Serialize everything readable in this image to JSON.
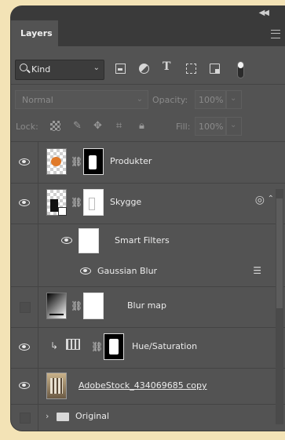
{
  "panel": {
    "tab_label": "Layers",
    "collapse_icon": "double-chevron-left-icon",
    "menu_icon": "hamburger-menu-icon"
  },
  "filter": {
    "kind_label": "Kind",
    "icons": [
      "pixel-filter-icon",
      "adjustment-filter-icon",
      "type-filter-icon",
      "shape-filter-icon",
      "smart-object-filter-icon",
      "filter-toggle-icon"
    ]
  },
  "blend": {
    "mode": "Normal",
    "opacity_label": "Opacity:",
    "opacity_value": "100%"
  },
  "lock": {
    "label": "Lock:",
    "fill_label": "Fill:",
    "fill_value": "100%"
  },
  "layers": [
    {
      "name": "Produkter",
      "visible": true
    },
    {
      "name": "Skygge",
      "visible": true
    },
    {
      "name": "Smart Filters",
      "visible": true
    },
    {
      "name": "Gaussian Blur",
      "visible": true
    },
    {
      "name": "Blur map",
      "visible": false
    },
    {
      "name": "Hue/Saturation",
      "visible": true
    },
    {
      "name": "AdobeStock_434069685 copy",
      "visible": true
    },
    {
      "name": "Original",
      "visible": false
    }
  ],
  "colors": {
    "panel_bg": "#535353",
    "tab_bar_bg": "#3a3a3a",
    "page_bg": "#f3e3b6"
  }
}
